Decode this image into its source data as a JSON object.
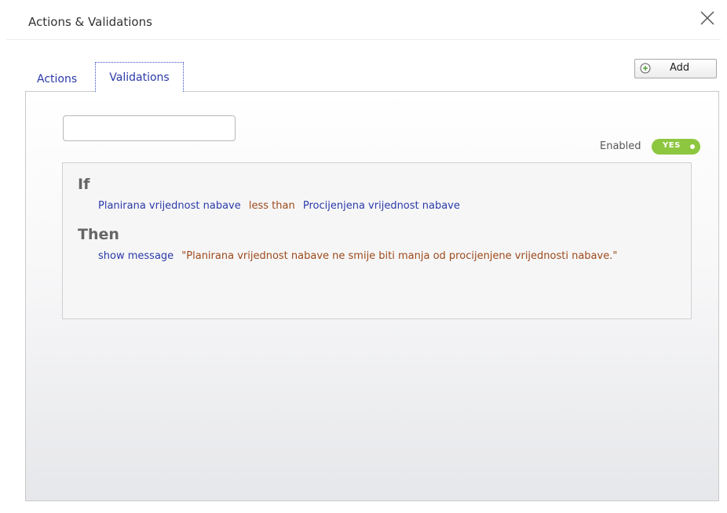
{
  "dialog": {
    "title": "Actions & Validations"
  },
  "tabs": [
    {
      "label": "Actions",
      "selected": false
    },
    {
      "label": "Validations",
      "selected": true
    }
  ],
  "toolbar": {
    "add_label": "Add",
    "add_icon": "plus-circle-icon"
  },
  "validation": {
    "name_value": "",
    "enabled_label": "Enabled",
    "enabled_toggle_text": "YES",
    "rule": {
      "if_keyword": "If",
      "condition": {
        "left_field": "Planirana vrijednost nabave",
        "operator": "less than",
        "right_field": "Procijenjena vrijednost nabave"
      },
      "then_keyword": "Then",
      "action": {
        "type": "show message",
        "message": "\"Planirana vrijednost nabave ne smije biti manja od procijenjene vrijednosti nabave.\""
      }
    }
  },
  "colors": {
    "link_blue": "#2b3aa8",
    "operator_brown": "#9c4a1a",
    "toggle_green": "#8dc63f"
  }
}
